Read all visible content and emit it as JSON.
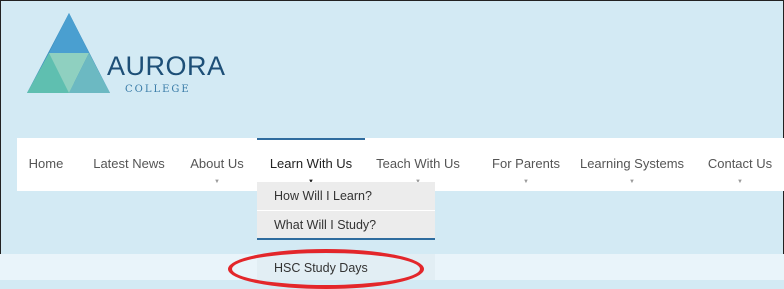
{
  "brand": {
    "name": "AURORA",
    "sub": "COLLEGE"
  },
  "colors": {
    "accent": "#2f6c9e",
    "highlight": "#e3262a",
    "background": "#d3eaf4"
  },
  "nav": {
    "items": [
      {
        "label": "Home"
      },
      {
        "label": "Latest News"
      },
      {
        "label": "About Us"
      },
      {
        "label": "Learn With Us",
        "active": true
      },
      {
        "label": "Teach With Us"
      },
      {
        "label": "For Parents"
      },
      {
        "label": "Learning Systems"
      },
      {
        "label": "Contact Us"
      }
    ]
  },
  "dropdown": {
    "items": [
      {
        "label": "How Will I Learn?"
      },
      {
        "label": "What Will I Study?"
      },
      {
        "label": "HSC Study Days",
        "highlighted": true
      }
    ]
  },
  "icons": {
    "chevron": "chevron-down-icon",
    "logo": "aurora-logo"
  }
}
